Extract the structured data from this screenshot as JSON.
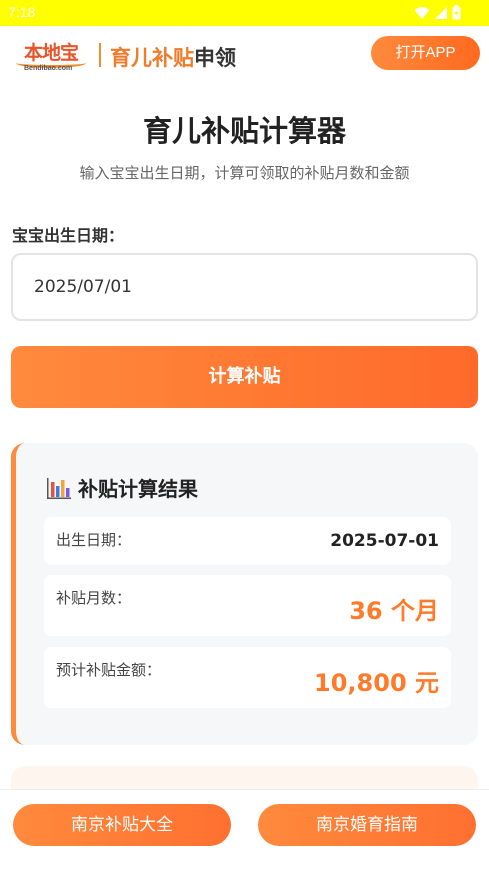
{
  "status_bar": {
    "time": "7:18"
  },
  "header": {
    "logo_cn": "本地宝",
    "logo_en": "Bendibao.com",
    "title_accent": "育儿补贴",
    "title_rest": "申领",
    "open_app_label": "打开APP"
  },
  "page": {
    "title": "育儿补贴计算器",
    "subtitle": "输入宝宝出生日期，计算可领取的补贴月数和金额"
  },
  "form": {
    "birth_label": "宝宝出生日期：",
    "birth_value": "2025/07/01",
    "submit_label": "计算补贴"
  },
  "result": {
    "title": "补贴计算结果",
    "rows": [
      {
        "label": "出生日期：",
        "value": "2025-07-01"
      },
      {
        "label": "补贴月数：",
        "value": "36 个月"
      },
      {
        "label": "预计补贴金额：",
        "value": "10,800 元"
      }
    ]
  },
  "bottom_nav": {
    "left_label": "南京补贴大全",
    "right_label": "南京婚育指南"
  },
  "colors": {
    "status_bar": "#ffff00",
    "accent": "#ff7a2a",
    "card_bg": "#f6f7f9"
  }
}
